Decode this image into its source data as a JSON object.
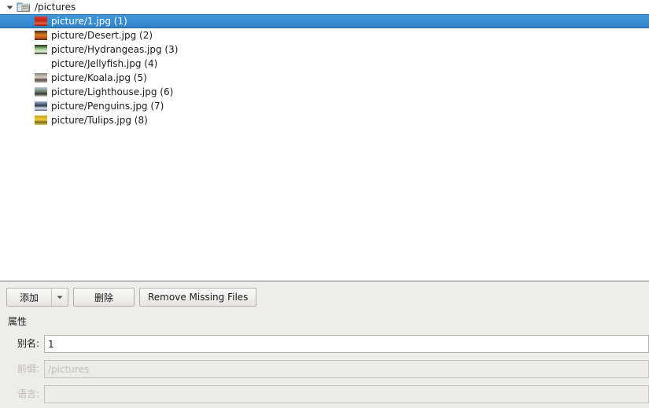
{
  "tree": {
    "root": {
      "label": "/pictures",
      "icon": "folder-icon",
      "expander_icon": "chevron-down-icon",
      "expanded": true
    },
    "items": [
      {
        "label": "picture/1.jpg (1)",
        "icon": "image-thumbnail-icon",
        "selected": true,
        "colors": [
          "#e2372a",
          "#b9281d",
          "#f05a3a",
          "#8d1c13"
        ]
      },
      {
        "label": "picture/Desert.jpg (2)",
        "icon": "image-thumbnail-icon",
        "selected": false,
        "colors": [
          "#3a2a22",
          "#e07a22",
          "#c8561a",
          "#4a2f20"
        ]
      },
      {
        "label": "picture/Hydrangeas.jpg (3)",
        "icon": "image-thumbnail-icon",
        "selected": false,
        "colors": [
          "#1d2b18",
          "#9fd08a",
          "#dfeadb",
          "#28401f"
        ]
      },
      {
        "label": "picture/Jellyfish.jpg (4)",
        "icon": "image-thumbnail-icon",
        "selected": false,
        "colors": [
          "#12305e",
          "#2f6fb5",
          "#d98ba8",
          "#0e2murky"
        ]
      },
      {
        "label": "picture/Koala.jpg (5)",
        "icon": "image-thumbnail-icon",
        "selected": false,
        "colors": [
          "#8d8378",
          "#d6cec2",
          "#5b5349",
          "#b4aa9c"
        ]
      },
      {
        "label": "picture/Lighthouse.jpg (6)",
        "icon": "image-thumbnail-icon",
        "selected": false,
        "colors": [
          "#b8ccdd",
          "#6d7f6a",
          "#3b3a32",
          "#e8e3d6"
        ]
      },
      {
        "label": "picture/Penguins.jpg (7)",
        "icon": "image-thumbnail-icon",
        "selected": false,
        "colors": [
          "#9fb9cf",
          "#2c3a52",
          "#dfe8ef",
          "#5a6b80"
        ]
      },
      {
        "label": "picture/Tulips.jpg (8)",
        "icon": "image-thumbnail-icon",
        "selected": false,
        "colors": [
          "#c8a31e",
          "#f0c93a",
          "#7e6a18",
          "#e8d862"
        ]
      }
    ]
  },
  "toolbar": {
    "add_label": "添加",
    "add_dropdown_icon": "chevron-down-icon",
    "delete_label": "删除",
    "remove_missing_label": "Remove Missing Files"
  },
  "properties": {
    "section_title": "属性",
    "fields": [
      {
        "label": "别名:",
        "value": "1",
        "disabled": false
      },
      {
        "label": "前缀:",
        "value": "/pictures",
        "disabled": true
      },
      {
        "label": "语言:",
        "value": "",
        "disabled": true
      }
    ]
  },
  "colors": {
    "selection": "#3a8fd2",
    "panel_bg": "#efedea",
    "list_bg": "#ffffff",
    "border": "#b4b0aa"
  }
}
